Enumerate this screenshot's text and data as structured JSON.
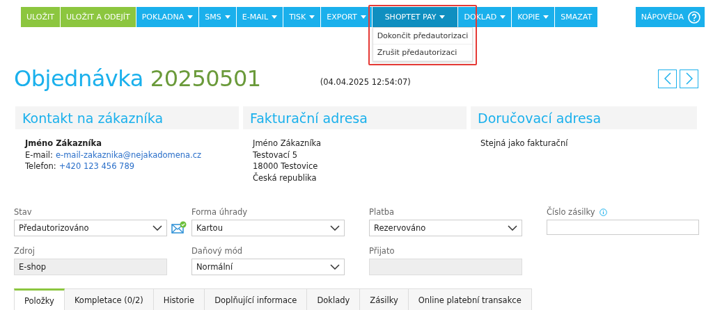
{
  "toolbar": {
    "buttons": [
      {
        "label": "ULOŽIT",
        "kind": "save",
        "dropdown": false,
        "open": false
      },
      {
        "label": "ULOŽIT A ODEJÍT",
        "kind": "save",
        "dropdown": false,
        "open": false
      },
      {
        "label": "POKLADNA",
        "kind": "menu",
        "dropdown": true,
        "open": false
      },
      {
        "label": "SMS",
        "kind": "menu",
        "dropdown": true,
        "open": false
      },
      {
        "label": "E-MAIL",
        "kind": "menu",
        "dropdown": true,
        "open": false
      },
      {
        "label": "TISK",
        "kind": "menu",
        "dropdown": true,
        "open": false
      },
      {
        "label": "EXPORT",
        "kind": "menu",
        "dropdown": true,
        "open": false
      },
      {
        "label": "SHOPTET PAY",
        "kind": "menu",
        "dropdown": true,
        "open": true,
        "menu_items": [
          "Dokončit předautorizaci",
          "Zrušit předautorizaci"
        ]
      },
      {
        "label": "DOKLAD",
        "kind": "menu",
        "dropdown": true,
        "open": false
      },
      {
        "label": "KOPIE",
        "kind": "menu",
        "dropdown": true,
        "open": false
      },
      {
        "label": "SMAZAT",
        "kind": "menu",
        "dropdown": false,
        "open": false
      }
    ],
    "help": {
      "label": "NÁPOVĚDA"
    }
  },
  "heading": {
    "title": "Objednávka",
    "number": "20250501",
    "date": "(04.04.2025 12:54:07)"
  },
  "cards": [
    {
      "title": "Kontakt na zákazníka",
      "lines": [
        {
          "kind": "name",
          "text": "Jméno Zákazníka"
        },
        {
          "kind": "link",
          "label": "E-mail:",
          "text": "e-mail-zakaznika@nejakadomena.cz"
        },
        {
          "kind": "link",
          "label": "Telefon:",
          "text": "+420 123 456 789"
        }
      ]
    },
    {
      "title": "Fakturační adresa",
      "lines": [
        {
          "kind": "plain",
          "text": "Jméno Zákazníka"
        },
        {
          "kind": "plain",
          "text": "Testovací 5"
        },
        {
          "kind": "plain",
          "text": "18000 Testovice"
        },
        {
          "kind": "plain",
          "text": "Česká republika"
        }
      ]
    },
    {
      "title": "Doručovací adresa",
      "lines": [
        {
          "kind": "plain",
          "text": "Stejná jako fakturační"
        }
      ]
    }
  ],
  "form": [
    [
      {
        "label": "Stav",
        "kind": "select",
        "value": "Předautorizováno",
        "mail_icon": true
      },
      {
        "label": "Zdroj",
        "kind": "readonly",
        "value": "E-shop"
      }
    ],
    [
      {
        "label": "Forma úhrady",
        "kind": "select",
        "value": "Kartou"
      },
      {
        "label": "Daňový mód",
        "kind": "select",
        "value": "Normální"
      }
    ],
    [
      {
        "label": "Platba",
        "kind": "select",
        "value": "Rezervováno"
      },
      {
        "label": "Přijato",
        "kind": "readonly"
      }
    ],
    [
      {
        "label": "Číslo zásilky",
        "kind": "input",
        "info": true
      }
    ]
  ],
  "tabs": [
    {
      "label": "Položky",
      "selected": true
    },
    {
      "label": "Kompletace (0/2)",
      "selected": false
    },
    {
      "label": "Historie",
      "selected": false
    },
    {
      "label": "Doplňující informace",
      "selected": false
    },
    {
      "label": "Doklady",
      "selected": false
    },
    {
      "label": "Zásilky",
      "selected": false
    },
    {
      "label": "Online platební transakce",
      "selected": false
    }
  ]
}
